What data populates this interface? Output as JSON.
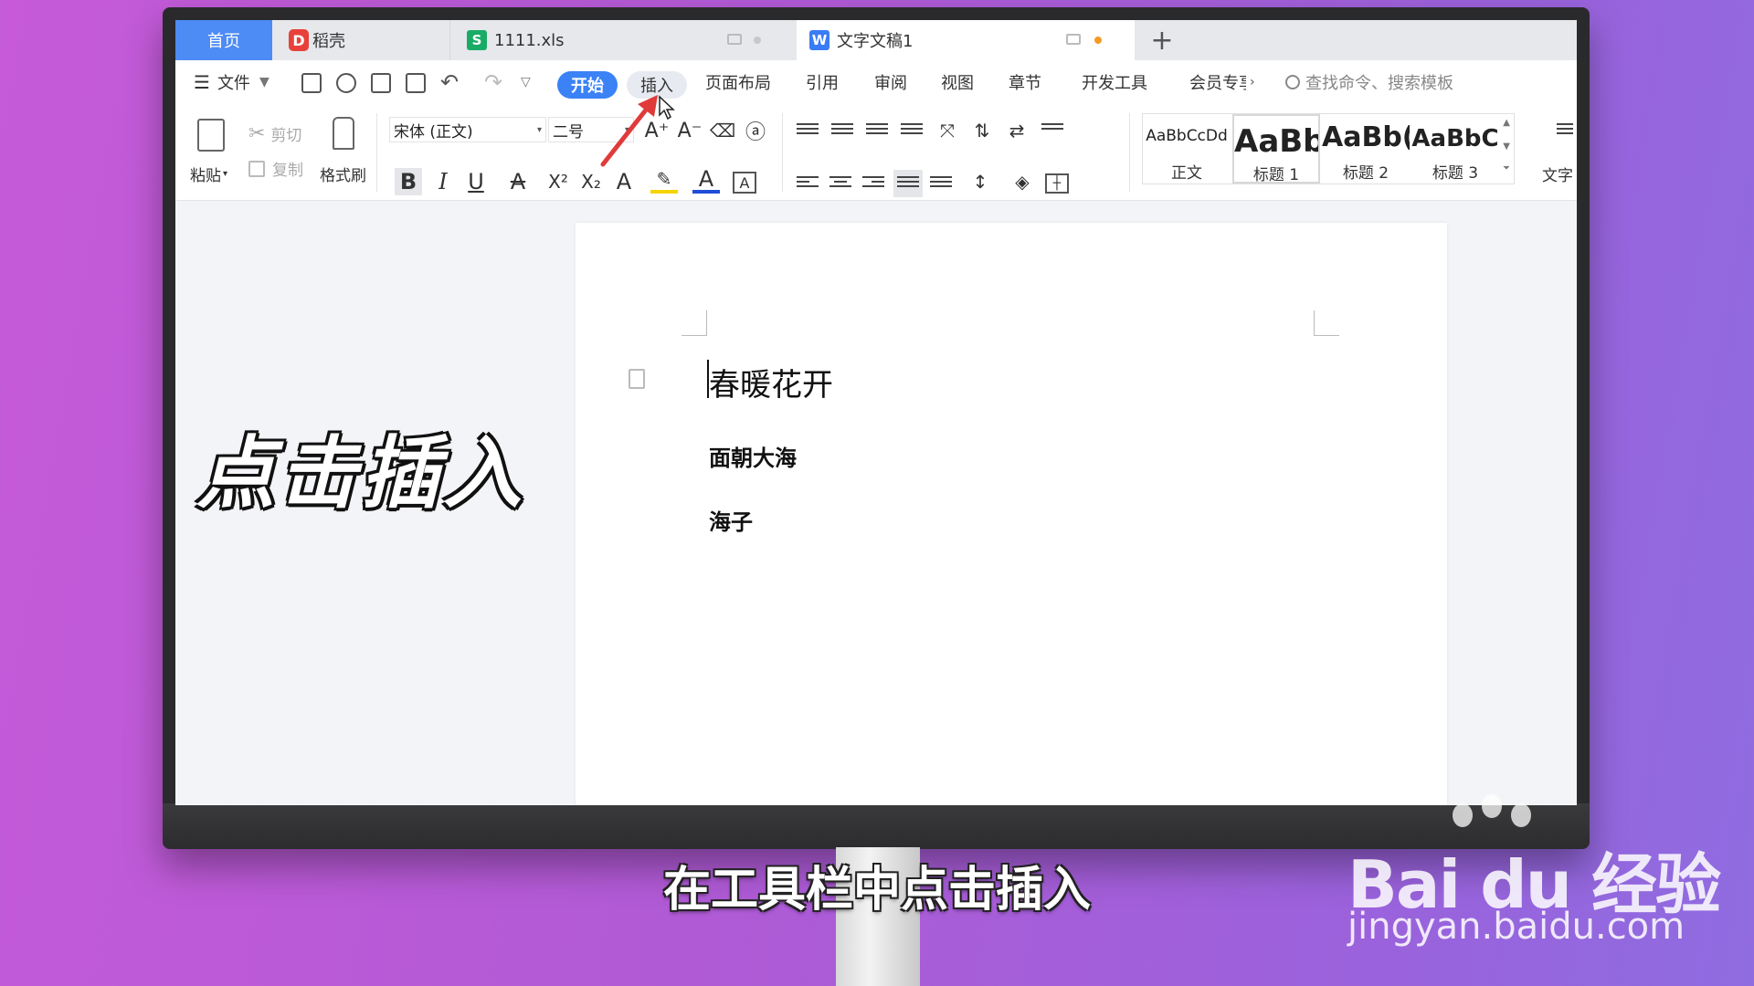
{
  "tabs": {
    "home": "首页",
    "tab1": "稻壳",
    "tab2": "1111.xls",
    "tab3": "文字文稿1",
    "add": "+"
  },
  "menu": {
    "file": "文件",
    "start": "开始",
    "insert": "插入",
    "layout": "页面布局",
    "reference": "引用",
    "review": "审阅",
    "view": "视图",
    "chapter": "章节",
    "dev": "开发工具",
    "member": "会员专享",
    "search_placeholder": "查找命令、搜索模板"
  },
  "ribbon": {
    "paste": "粘贴",
    "cut": "剪切",
    "copy": "复制",
    "format_painter": "格式刷",
    "font_name": "宋体 (正文)",
    "font_size": "二号",
    "styles": [
      {
        "sample": "AaBbCcDd",
        "name": "正文"
      },
      {
        "sample": "AaBb",
        "name": "标题 1"
      },
      {
        "sample": "AaBb(",
        "name": "标题 2"
      },
      {
        "sample": "AaBbC",
        "name": "标题 3"
      }
    ],
    "text_tool": "文字"
  },
  "document": {
    "title": "春暖花开",
    "line2": "面朝大海",
    "line3": "海子"
  },
  "overlay": {
    "headline": "点击插入",
    "subtitle": "在工具栏中点击插入",
    "watermark_logo": "Bai du 经验",
    "watermark_url": "jingyan.baidu.com"
  },
  "colors": {
    "accent": "#3b82f6",
    "home_tab": "#4d8bf5",
    "arrow": "#e03a3a"
  }
}
